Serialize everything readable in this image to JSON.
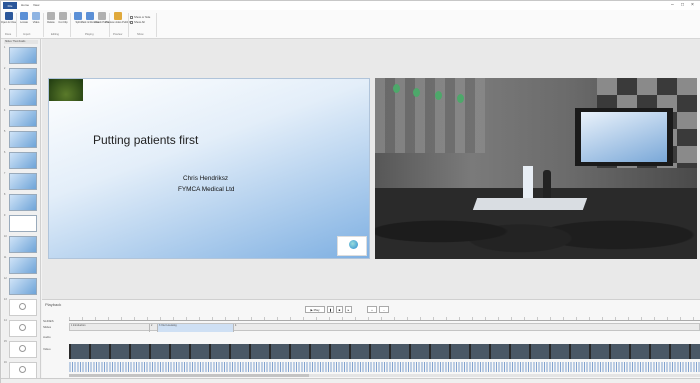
{
  "ribbon_tabs": [
    "File",
    "Home",
    "View"
  ],
  "ribbon": {
    "buttons": [
      {
        "id": "open",
        "label": "Open & Close",
        "color": "#2b579a"
      },
      {
        "id": "lock",
        "label": "Locate",
        "color": "#5a8fd6"
      },
      {
        "id": "video",
        "label": "Video",
        "color": "#8db3e2"
      },
      {
        "id": "delete",
        "label": "Delete",
        "color": "#b0b0b0"
      },
      {
        "id": "cut",
        "label": "Cut Clip",
        "color": "#b0b0b0"
      },
      {
        "id": "split",
        "label": "Split",
        "color": "#5a8fd6"
      },
      {
        "id": "mark",
        "label": "Mark & Remove",
        "color": "#5a8fd6"
      },
      {
        "id": "check",
        "label": "Check Points",
        "color": "#b0b0b0"
      },
      {
        "id": "preview",
        "label": "Preview video Publish",
        "color": "#e0a93b"
      }
    ],
    "groups": [
      "Done",
      "Import",
      "Editing",
      "Playing",
      "Preview",
      "Show"
    ],
    "checks": [
      "Show or hide",
      "Show All"
    ]
  },
  "slide_pane": {
    "header": "Slides Thumbnails"
  },
  "slide": {
    "title": "Putting patients first",
    "presenter": "Chris Hendriksz",
    "organization": "FYMCA Medical Ltd"
  },
  "playback": {
    "label": "Playback",
    "play_label": "Play",
    "tracks": [
      "SLIDES",
      "Slides",
      "Audio",
      "Video"
    ],
    "segments": [
      "1 Introduction",
      "2",
      "3 Your Licensing",
      "4"
    ]
  }
}
